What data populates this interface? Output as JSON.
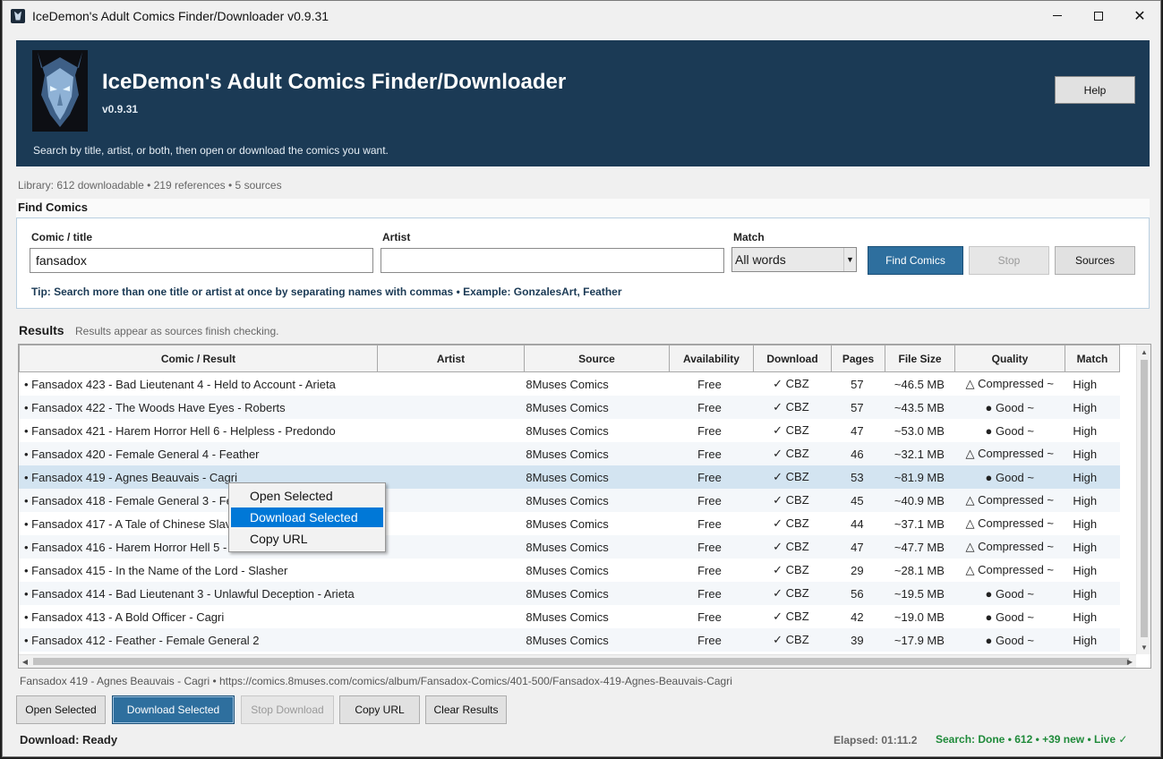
{
  "window": {
    "title": "IceDemon's Adult Comics Finder/Downloader v0.9.31"
  },
  "banner": {
    "title": "IceDemon's Adult Comics Finder/Downloader",
    "version": "v0.9.31",
    "subtitle": "Search by title, artist, or both, then open or download the comics you want.",
    "help_label": "Help",
    "bg_color": "#1b3a55"
  },
  "library": {
    "info": "Library: 612 downloadable • 219 references • 5 sources"
  },
  "find": {
    "section_label": "Find Comics",
    "title_label": "Comic / title",
    "title_value": "fansadox",
    "artist_label": "Artist",
    "artist_value": "",
    "match_label": "Match",
    "match_value": "All words",
    "find_button": "Find Comics",
    "stop_button": "Stop",
    "sources_button": "Sources",
    "tip": "Tip: Search more than one title or artist at once by separating names with commas  •  Example: GonzalesArt, Feather"
  },
  "results": {
    "label": "Results",
    "hint": "Results appear as sources finish checking.",
    "columns": [
      "Comic / Result",
      "Artist",
      "Source",
      "Availability",
      "Download",
      "Pages",
      "File Size",
      "Quality",
      "Match"
    ],
    "rows": [
      {
        "title": "• Fansadox 423 - Bad Lieutenant 4 - Held to Account - Arieta",
        "artist": "",
        "source": "8Muses Comics",
        "availability": "Free",
        "download": "✓  CBZ",
        "pages": "57",
        "size": "~46.5 MB",
        "quality": "△ Compressed ~",
        "match": "High"
      },
      {
        "title": "• Fansadox 422 - The Woods Have Eyes - Roberts",
        "artist": "",
        "source": "8Muses Comics",
        "availability": "Free",
        "download": "✓  CBZ",
        "pages": "57",
        "size": "~43.5 MB",
        "quality": "● Good ~",
        "match": "High"
      },
      {
        "title": "• Fansadox 421 - Harem Horror Hell 6 - Helpless - Predondo",
        "artist": "",
        "source": "8Muses Comics",
        "availability": "Free",
        "download": "✓  CBZ",
        "pages": "47",
        "size": "~53.0 MB",
        "quality": "● Good ~",
        "match": "High"
      },
      {
        "title": "• Fansadox 420 - Female General 4 - Feather",
        "artist": "",
        "source": "8Muses Comics",
        "availability": "Free",
        "download": "✓  CBZ",
        "pages": "46",
        "size": "~32.1 MB",
        "quality": "△ Compressed ~",
        "match": "High"
      },
      {
        "title": "• Fansadox 419 - Agnes Beauvais - Cagri",
        "artist": "",
        "source": "8Muses Comics",
        "availability": "Free",
        "download": "✓  CBZ",
        "pages": "53",
        "size": "~81.9 MB",
        "quality": "● Good ~",
        "match": "High"
      },
      {
        "title": "• Fansadox 418 - Female General 3 - Feather",
        "artist": "",
        "source": "8Muses Comics",
        "availability": "Free",
        "download": "✓  CBZ",
        "pages": "45",
        "size": "~40.9 MB",
        "quality": "△ Compressed ~",
        "match": "High"
      },
      {
        "title": "• Fansadox 417 - A Tale of Chinese Slavery - Predondo",
        "artist": "",
        "source": "8Muses Comics",
        "availability": "Free",
        "download": "✓  CBZ",
        "pages": "44",
        "size": "~37.1 MB",
        "quality": "△ Compressed ~",
        "match": "High"
      },
      {
        "title": "• Fansadox 416 - Harem Horror Hell 5 - Insatiable - Predondo",
        "artist": "",
        "source": "8Muses Comics",
        "availability": "Free",
        "download": "✓  CBZ",
        "pages": "47",
        "size": "~47.7 MB",
        "quality": "△ Compressed ~",
        "match": "High"
      },
      {
        "title": "• Fansadox 415 - In the Name of the Lord - Slasher",
        "artist": "",
        "source": "8Muses Comics",
        "availability": "Free",
        "download": "✓  CBZ",
        "pages": "29",
        "size": "~28.1 MB",
        "quality": "△ Compressed ~",
        "match": "High"
      },
      {
        "title": "• Fansadox 414 - Bad Lieutenant 3 - Unlawful Deception - Arieta",
        "artist": "",
        "source": "8Muses Comics",
        "availability": "Free",
        "download": "✓  CBZ",
        "pages": "56",
        "size": "~19.5 MB",
        "quality": "● Good ~",
        "match": "High"
      },
      {
        "title": "• Fansadox 413 - A Bold Officer - Cagri",
        "artist": "",
        "source": "8Muses Comics",
        "availability": "Free",
        "download": "✓  CBZ",
        "pages": "42",
        "size": "~19.0 MB",
        "quality": "● Good ~",
        "match": "High"
      },
      {
        "title": "• Fansadox 412 - Feather - Female General 2",
        "artist": "",
        "source": "8Muses Comics",
        "availability": "Free",
        "download": "✓  CBZ",
        "pages": "39",
        "size": "~17.9 MB",
        "quality": "● Good ~",
        "match": "High"
      }
    ]
  },
  "context_menu": {
    "items": [
      "Open Selected",
      "Download Selected",
      "Copy URL"
    ]
  },
  "selection": {
    "info": "Fansadox 419 - Agnes Beauvais - Cagri  •  https://comics.8muses.com/comics/album/Fansadox-Comics/401-500/Fansadox-419-Agnes-Beauvais-Cagri"
  },
  "actions": {
    "open": "Open Selected",
    "download": "Download Selected",
    "stop": "Stop Download",
    "copy": "Copy URL",
    "clear": "Clear Results"
  },
  "status": {
    "download": "Download: Ready",
    "elapsed": "Elapsed: 01:11.2",
    "search": "Search: Done • 612 • +39 new • Live ✓"
  }
}
